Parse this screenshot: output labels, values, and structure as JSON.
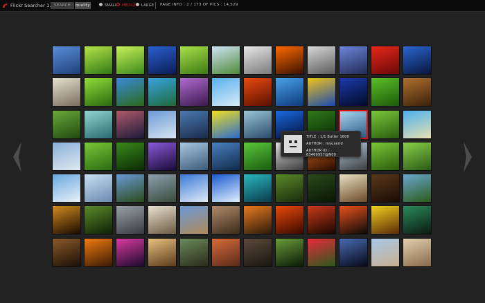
{
  "app": {
    "title": "Flickr Searcher 1.0"
  },
  "toolbar": {
    "search_label": "SEARCH",
    "query_label": "quality",
    "sizes": [
      {
        "label": "SMALL",
        "selected": false
      },
      {
        "label": "MEDIUM",
        "selected": true
      },
      {
        "label": "LARGE",
        "selected": false
      }
    ],
    "page_info": "PAGE INFO : 2 / 173 OF PICS : 14,529"
  },
  "nav": {
    "prev_icon": "chevron-left-icon",
    "next_icon": "chevron-right-icon"
  },
  "grid": {
    "columns": 12,
    "rows": 7,
    "selected_index": 33,
    "thumbs": [
      {
        "c1": "#5a8fd6",
        "c2": "#1f3f7a"
      },
      {
        "c1": "#b7e34a",
        "c2": "#2f7a14"
      },
      {
        "c1": "#c9f05a",
        "c2": "#3b8a1a"
      },
      {
        "c1": "#2a5fd0",
        "c2": "#0a1d55"
      },
      {
        "c1": "#a8e04a",
        "c2": "#3d7a12"
      },
      {
        "c1": "#cfe2f5",
        "c2": "#4f8a3a"
      },
      {
        "c1": "#e6e6e6",
        "c2": "#7a7a7a"
      },
      {
        "c1": "#ff6a00",
        "c2": "#3a1000"
      },
      {
        "c1": "#d8d8d8",
        "c2": "#5a5a5a"
      },
      {
        "c1": "#6a85d9",
        "c2": "#222a55"
      },
      {
        "c1": "#e8281a",
        "c2": "#6a0808"
      },
      {
        "c1": "#2b66d0",
        "c2": "#08153d"
      },
      {
        "c1": "#e5e0d2",
        "c2": "#7a6e5a"
      },
      {
        "c1": "#8fdc3a",
        "c2": "#2a6a0f"
      },
      {
        "c1": "#3a8ad8",
        "c2": "#2b6a1a"
      },
      {
        "c1": "#3aa2e0",
        "c2": "#1c6a3a"
      },
      {
        "c1": "#b06ad0",
        "c2": "#3a1a4d"
      },
      {
        "c1": "#5ab0f0",
        "c2": "#d6ecf7"
      },
      {
        "c1": "#e84a10",
        "c2": "#5a1000"
      },
      {
        "c1": "#4aa0e8",
        "c2": "#0d3a7a"
      },
      {
        "c1": "#f0c21a",
        "c2": "#1a4ab0"
      },
      {
        "c1": "#1a3aa8",
        "c2": "#030a2a"
      },
      {
        "c1": "#5ac02a",
        "c2": "#1c5a0a"
      },
      {
        "c1": "#b07030",
        "c2": "#3a2008"
      },
      {
        "c1": "#6aa83a",
        "c2": "#1f4a10"
      },
      {
        "c1": "#8fd6d0",
        "c2": "#2a6a70"
      },
      {
        "c1": "#b05a6a",
        "c2": "#1a1a3a"
      },
      {
        "c1": "#6a9ad8",
        "c2": "#d8e4f0"
      },
      {
        "c1": "#4a7ab0",
        "c2": "#1a2a4a"
      },
      {
        "c1": "#f0e020",
        "c2": "#2a6ad0"
      },
      {
        "c1": "#9ac4d6",
        "c2": "#2a4a6a"
      },
      {
        "c1": "#1a6ae0",
        "c2": "#030f3a"
      },
      {
        "c1": "#2f7a1a",
        "c2": "#0a2a05"
      },
      {
        "c1": "#a8d4ea",
        "c2": "#2a5a8a"
      },
      {
        "c1": "#7ac83a",
        "c2": "#2a5a10"
      },
      {
        "c1": "#4ab0f0",
        "c2": "#e8e0b0"
      },
      {
        "c1": "#8ab0d8",
        "c2": "#e0e8f0"
      },
      {
        "c1": "#7ac83a",
        "c2": "#2a6a10"
      },
      {
        "c1": "#3a8a1a",
        "c2": "#0a2a05"
      },
      {
        "c1": "#8a5ad8",
        "c2": "#1a0a3a"
      },
      {
        "c1": "#a8c8e0",
        "c2": "#3a5a7a"
      },
      {
        "c1": "#4a80c0",
        "c2": "#0f2a4a"
      },
      {
        "c1": "#5ac83a",
        "c2": "#1a5a10"
      },
      {
        "c1": "#e0e0e0",
        "c2": "#3a3a3a"
      },
      {
        "c1": "#d06a20",
        "c2": "#2a0a00"
      },
      {
        "c1": "#b8d0e8",
        "c2": "#3a3a3a"
      },
      {
        "c1": "#7ac83a",
        "c2": "#2a5a0a"
      },
      {
        "c1": "#8ad04a",
        "c2": "#2a5a15"
      },
      {
        "c1": "#6aa8e0",
        "c2": "#e8f0f8"
      },
      {
        "c1": "#c8e0f0",
        "c2": "#6a8ab0"
      },
      {
        "c1": "#6a9ad8",
        "c2": "#2a4a1a"
      },
      {
        "c1": "#8aa0b0",
        "c2": "#3a4a3a"
      },
      {
        "c1": "#3a7ad8",
        "c2": "#e0eaf5"
      },
      {
        "c1": "#1a5ad0",
        "c2": "#e0f0ff"
      },
      {
        "c1": "#2ab8c0",
        "c2": "#0a3a4a"
      },
      {
        "c1": "#5a8a2a",
        "c2": "#1a2a0a"
      },
      {
        "c1": "#2a4a1a",
        "c2": "#0a1505"
      },
      {
        "c1": "#e8e0c0",
        "c2": "#6a4a2a"
      },
      {
        "c1": "#5a3a1a",
        "c2": "#1a0a05"
      },
      {
        "c1": "#6aa8d0",
        "c2": "#2a5a1a"
      },
      {
        "c1": "#d08a20",
        "c2": "#1a0a00"
      },
      {
        "c1": "#5a8a2a",
        "c2": "#0f1f05"
      },
      {
        "c1": "#9aa0a8",
        "c2": "#3a3a40"
      },
      {
        "c1": "#e8e0d0",
        "c2": "#6a5a40"
      },
      {
        "c1": "#6a9ad8",
        "c2": "#b08a5a"
      },
      {
        "c1": "#b08a6a",
        "c2": "#3a2a1a"
      },
      {
        "c1": "#e87a20",
        "c2": "#2a1a0a"
      },
      {
        "c1": "#e8480a",
        "c2": "#3a0800"
      },
      {
        "c1": "#c83a1a",
        "c2": "#1a0500"
      },
      {
        "c1": "#e8501a",
        "c2": "#0a0a0a"
      },
      {
        "c1": "#f0d020",
        "c2": "#5a2a05"
      },
      {
        "c1": "#2a8a5a",
        "c2": "#0a1a10"
      },
      {
        "c1": "#8a5a2a",
        "c2": "#1a0f05"
      },
      {
        "c1": "#f07a10",
        "c2": "#3a1a05"
      },
      {
        "c1": "#d83aa0",
        "c2": "#1a0a2a"
      },
      {
        "c1": "#e8c080",
        "c2": "#5a3a1a"
      },
      {
        "c1": "#6a8a5a",
        "c2": "#2a2a1a"
      },
      {
        "c1": "#d86a3a",
        "c2": "#5a2a1a"
      },
      {
        "c1": "#5a4a3a",
        "c2": "#1a1510"
      },
      {
        "c1": "#6a9a3a",
        "c2": "#0a1a05"
      },
      {
        "c1": "#e82a3a",
        "c2": "#2a5a1a"
      },
      {
        "c1": "#4a6ab0",
        "c2": "#05081a"
      },
      {
        "c1": "#a8c8e8",
        "c2": "#c8b090"
      },
      {
        "c1": "#e0d0b0",
        "c2": "#8a6a4a"
      }
    ]
  },
  "tooltip": {
    "title": "TITLE : 1/1 Butler 1600",
    "author": "AUTHOR : myuserid",
    "author_id": "AUTHOR ID : 63469957@N00"
  },
  "colors": {
    "accent": "#e31e24",
    "background": "#222222",
    "bar": "#0b0b0b"
  }
}
